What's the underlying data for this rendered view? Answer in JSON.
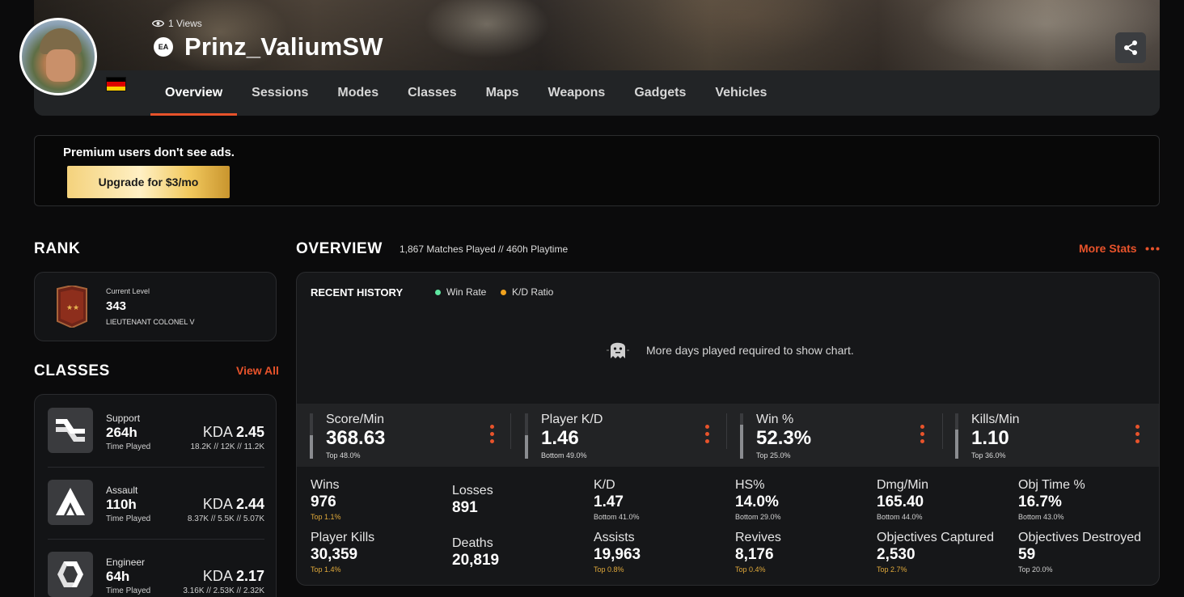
{
  "header": {
    "views": "1 Views",
    "platform_icon_text": "EA",
    "player_name": "Prinz_ValiumSW",
    "tabs": [
      "Overview",
      "Sessions",
      "Modes",
      "Classes",
      "Maps",
      "Weapons",
      "Gadgets",
      "Vehicles"
    ],
    "active_tab": "Overview",
    "flag_colors": [
      "#000000",
      "#dd0000",
      "#ffce00"
    ]
  },
  "premium": {
    "message": "Premium users don't see ads.",
    "upgrade_label": "Upgrade for $3/mo"
  },
  "rank": {
    "title": "RANK",
    "label": "Current Level",
    "level": "343",
    "name": "LIEUTENANT COLONEL V"
  },
  "classes": {
    "title": "CLASSES",
    "view_all": "View All",
    "kda_label": "KDA",
    "items": [
      {
        "name": "Support",
        "hours": "264h",
        "sub": "Time Played",
        "kda": "2.45",
        "kda_detail": "18.2K // 12K // 11.2K"
      },
      {
        "name": "Assault",
        "hours": "110h",
        "sub": "Time Played",
        "kda": "2.44",
        "kda_detail": "8.37K // 5.5K // 5.07K"
      },
      {
        "name": "Engineer",
        "hours": "64h",
        "sub": "Time Played",
        "kda": "2.17",
        "kda_detail": "3.16K // 2.53K // 2.32K"
      }
    ]
  },
  "overview": {
    "title": "OVERVIEW",
    "meta": "1,867 Matches Played // 460h Playtime",
    "more_stats": "More Stats",
    "recent_history": "RECENT HISTORY",
    "legend": [
      {
        "label": "Win Rate",
        "color": "#5ee6a0"
      },
      {
        "label": "K/D Ratio",
        "color": "#f0a21e"
      }
    ],
    "no_chart_msg": "More days played required to show chart.",
    "main_stats": [
      {
        "label": "Score/Min",
        "value": "368.63",
        "rank": "Top 48.0%",
        "fill": 0.52
      },
      {
        "label": "Player K/D",
        "value": "1.46",
        "rank": "Bottom 49.0%",
        "fill": 0.51
      },
      {
        "label": "Win %",
        "value": "52.3%",
        "rank": "Top 25.0%",
        "fill": 0.75
      },
      {
        "label": "Kills/Min",
        "value": "1.10",
        "rank": "Top 36.0%",
        "fill": 0.64
      }
    ],
    "stats": [
      {
        "label": "Wins",
        "value": "976",
        "rank": "Top 1.1%",
        "tone": "gold"
      },
      {
        "label": "Losses",
        "value": "891",
        "rank": "",
        "tone": "grey"
      },
      {
        "label": "K/D",
        "value": "1.47",
        "rank": "Bottom 41.0%",
        "tone": "grey"
      },
      {
        "label": "HS%",
        "value": "14.0%",
        "rank": "Bottom 29.0%",
        "tone": "grey"
      },
      {
        "label": "Dmg/Min",
        "value": "165.40",
        "rank": "Bottom 44.0%",
        "tone": "grey"
      },
      {
        "label": "Obj Time %",
        "value": "16.7%",
        "rank": "Bottom 43.0%",
        "tone": "grey"
      },
      {
        "label": "Player Kills",
        "value": "30,359",
        "rank": "Top 1.4%",
        "tone": "gold"
      },
      {
        "label": "Deaths",
        "value": "20,819",
        "rank": "",
        "tone": "grey"
      },
      {
        "label": "Assists",
        "value": "19,963",
        "rank": "Top 0.8%",
        "tone": "gold"
      },
      {
        "label": "Revives",
        "value": "8,176",
        "rank": "Top 0.4%",
        "tone": "gold"
      },
      {
        "label": "Objectives Captured",
        "value": "2,530",
        "rank": "Top 2.7%",
        "tone": "gold"
      },
      {
        "label": "Objectives Destroyed",
        "value": "59",
        "rank": "Top 20.0%",
        "tone": "grey"
      }
    ]
  }
}
